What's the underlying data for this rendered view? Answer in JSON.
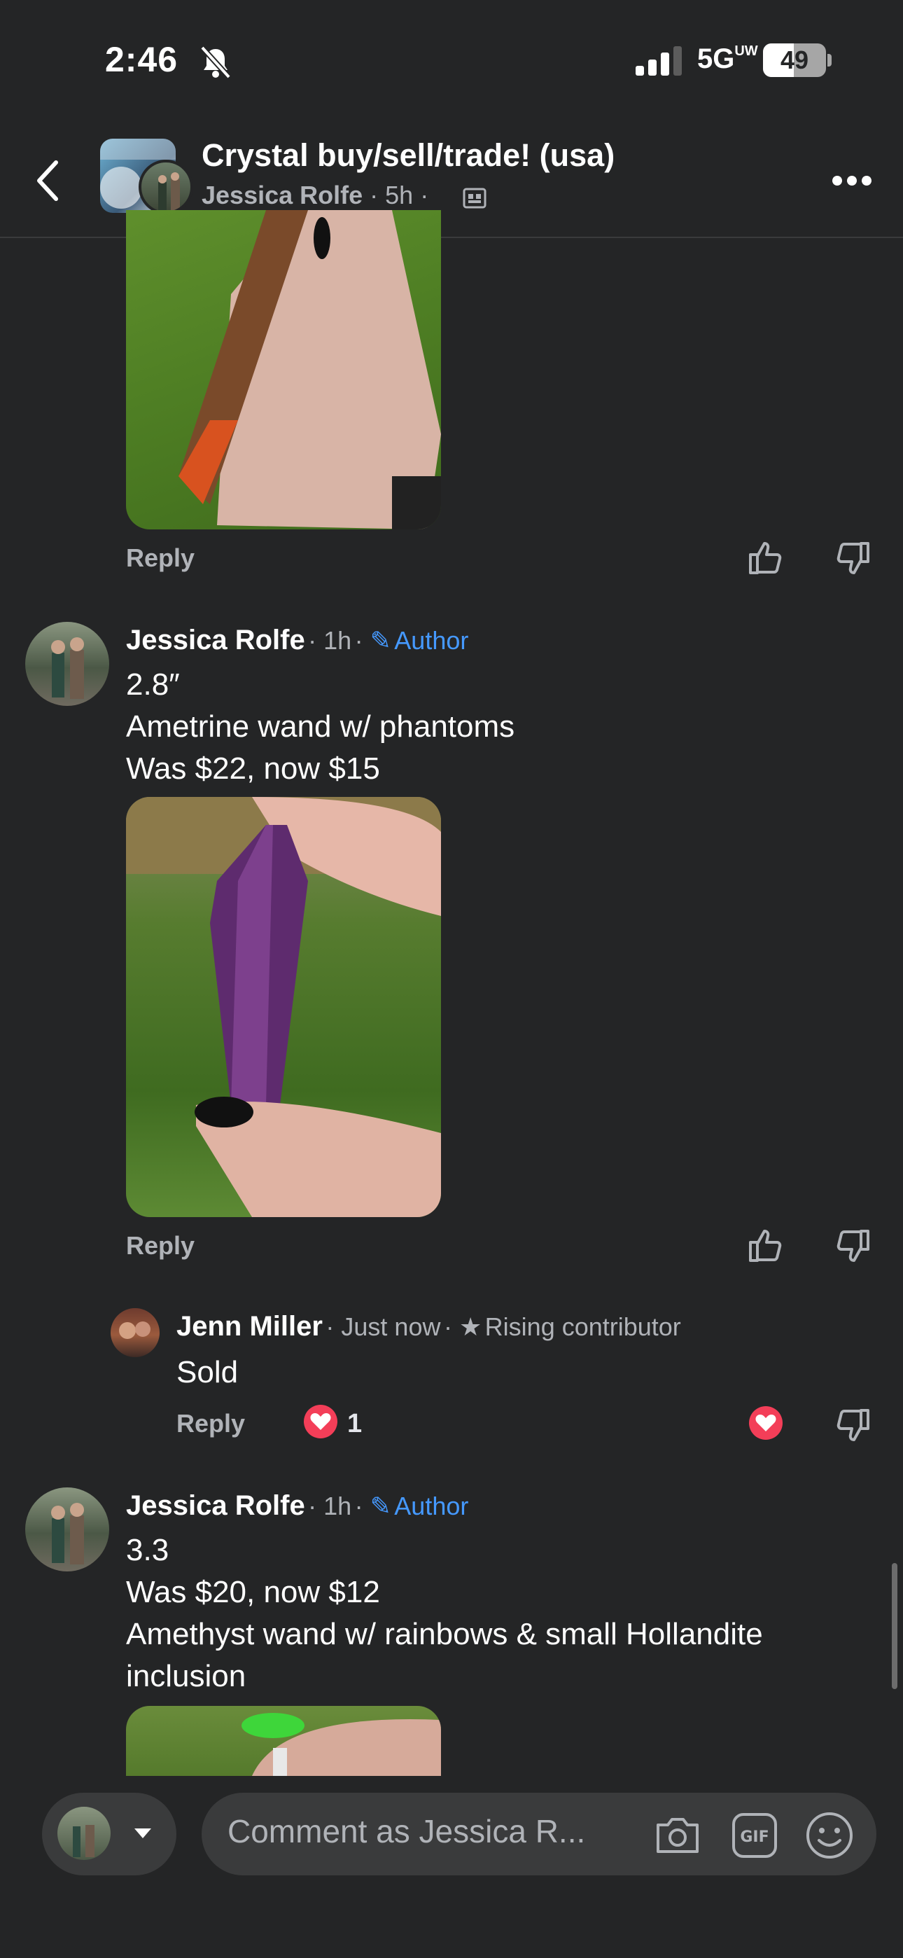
{
  "status_bar": {
    "time": "2:46",
    "network": "5G",
    "network_sup": "UW",
    "battery": "49",
    "battery_level": 0.49
  },
  "header": {
    "group_title": "Crystal buy/sell/trade! (usa)",
    "poster": "Jessica Rolfe",
    "time": "5h"
  },
  "comments": [
    {
      "reply_label": "Reply"
    },
    {
      "author": "Jessica Rolfe",
      "time": "1h",
      "badge": "Author",
      "lines": [
        "2.8″",
        "Ametrine wand w/ phantoms",
        "Was $22, now $15"
      ],
      "reply_label": "Reply",
      "replies": [
        {
          "author": "Jenn Miller",
          "time": "Just now",
          "badge": "Rising contributor",
          "text": "Sold",
          "reply_label": "Reply",
          "reaction_count": "1"
        }
      ]
    },
    {
      "author": "Jessica Rolfe",
      "time": "1h",
      "badge": "Author",
      "lines": [
        "3.3",
        "Was $20, now $12",
        "Amethyst wand w/ rainbows & small Hollandite",
        "inclusion"
      ]
    }
  ],
  "composer": {
    "placeholder": "Comment as Jessica R..."
  },
  "colors": {
    "background": "#242526",
    "author_badge": "#4599ff",
    "heart": "#f33e58"
  }
}
